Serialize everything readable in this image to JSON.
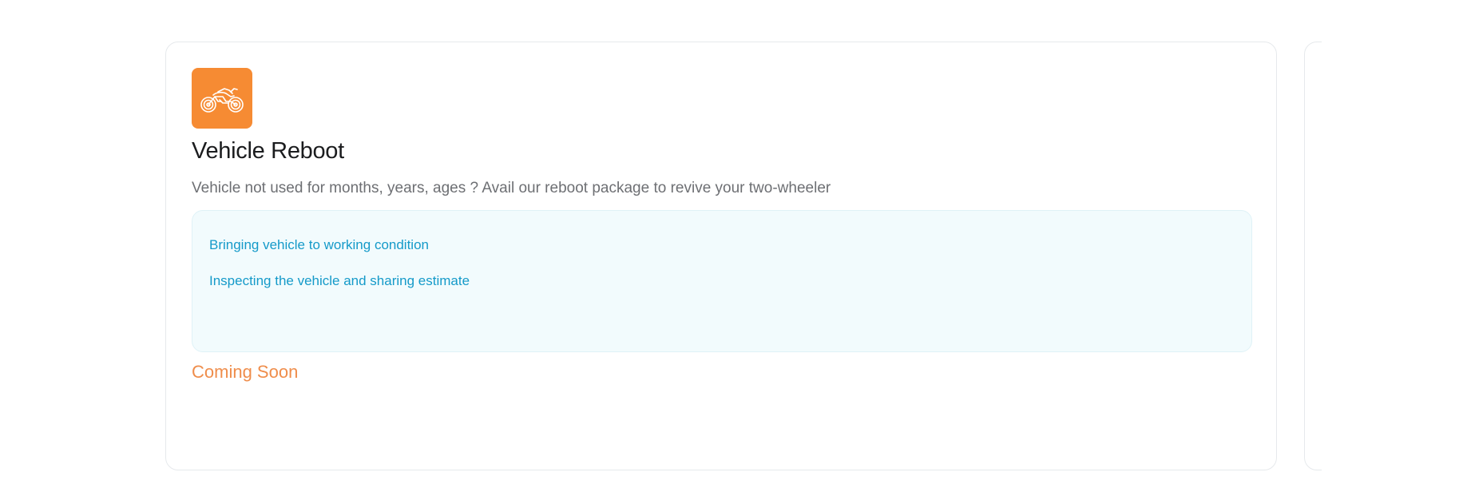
{
  "service_card": {
    "icon": "motorcycle-icon",
    "title": "Vehicle Reboot",
    "description": "Vehicle not used for months, years, ages ? Avail our reboot package to revive your two-wheeler",
    "features": [
      "Bringing vehicle to working condition",
      "Inspecting the vehicle and sharing estimate"
    ],
    "status": "Coming Soon"
  },
  "colors": {
    "icon_background": "#f68b33",
    "feature_text": "#159ac9",
    "feature_background": "#f2fbfd",
    "status_text": "#ef8d4b",
    "title_text": "#1b1c1e",
    "description_text": "#6d6f73"
  }
}
